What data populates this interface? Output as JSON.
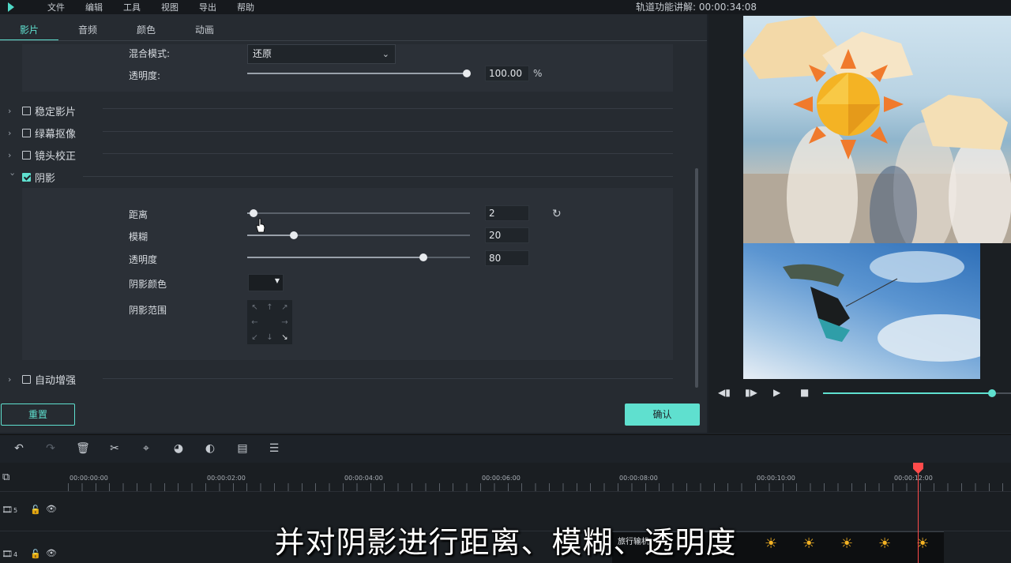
{
  "menubar": {
    "items": [
      "文件",
      "编辑",
      "工具",
      "视图",
      "导出",
      "帮助"
    ],
    "timecode": "轨道功能讲解: 00:00:34:08"
  },
  "tabs": [
    "影片",
    "音频",
    "颜色",
    "动画"
  ],
  "blend": {
    "mode_label": "混合模式:",
    "mode_value": "还原",
    "opacity_label": "透明度:",
    "opacity_value": "100.00",
    "opacity_unit": "%",
    "opacity_fraction": 1.0
  },
  "sections": [
    {
      "label": "稳定影片",
      "checked": false
    },
    {
      "label": "绿幕抠像",
      "checked": false
    },
    {
      "label": "镜头校正",
      "checked": false
    },
    {
      "label": "阴影",
      "checked": true
    },
    {
      "label": "自动增强",
      "checked": false
    }
  ],
  "shadow": {
    "distance_label": "距离",
    "distance_value": "2",
    "distance_fraction": 0.03,
    "blur_label": "模糊",
    "blur_value": "20",
    "blur_fraction": 0.21,
    "opacity_label": "透明度",
    "opacity_value": "80",
    "opacity_fraction": 0.79,
    "color_label": "阴影颜色",
    "range_label": "阴影范围",
    "shadow_color": "#1a1e22"
  },
  "buttons": {
    "reset": "重置",
    "ok": "确认"
  },
  "timeline": {
    "ticks": [
      "00:00:00:00",
      "00:00:02:00",
      "00:00:04:00",
      "00:00:06:00",
      "00:00:08:00",
      "00:00:10:00",
      "00:00:12:00"
    ],
    "tracks": [
      "5",
      "4"
    ],
    "clip_label": "旅行输机"
  },
  "subtitle": "并对阴影进行距离、模糊、透明度",
  "colors": {
    "accent": "#5fe0cf",
    "playhead": "#ff4b4b"
  }
}
